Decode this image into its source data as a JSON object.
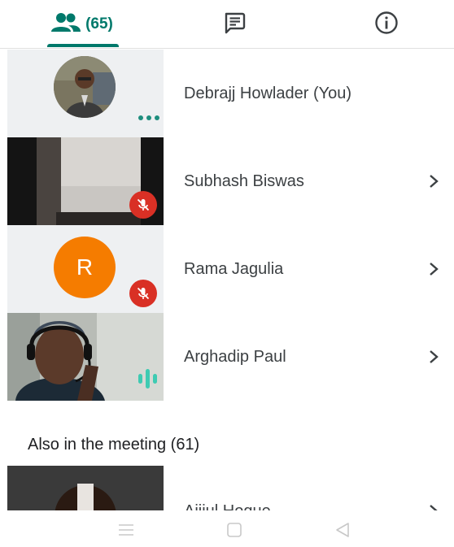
{
  "tabs": {
    "people_count": "(65)",
    "people_icon": "people-icon",
    "chat_icon": "chat-icon",
    "info_icon": "info-icon"
  },
  "participants": [
    {
      "name": "Debrajj Howlader (You)",
      "tile": "avatar-photo",
      "status": "more-options"
    },
    {
      "name": "Subhash Biswas",
      "tile": "video",
      "status": "mic-off"
    },
    {
      "name": "Rama Jagulia",
      "tile": "letter-avatar",
      "avatar_letter": "R",
      "status": "mic-off"
    },
    {
      "name": "Arghadip Paul",
      "tile": "video",
      "status": "speaking"
    }
  ],
  "also_in_meeting": {
    "title": "Also in the meeting (61)",
    "first_name": "Ajijul Hoque"
  },
  "colors": {
    "accent": "#00796b",
    "mic_off": "#d93025",
    "avatar_orange": "#f57c00"
  },
  "navbar": {
    "icons": [
      "menu-icon",
      "home-icon",
      "back-icon"
    ]
  }
}
